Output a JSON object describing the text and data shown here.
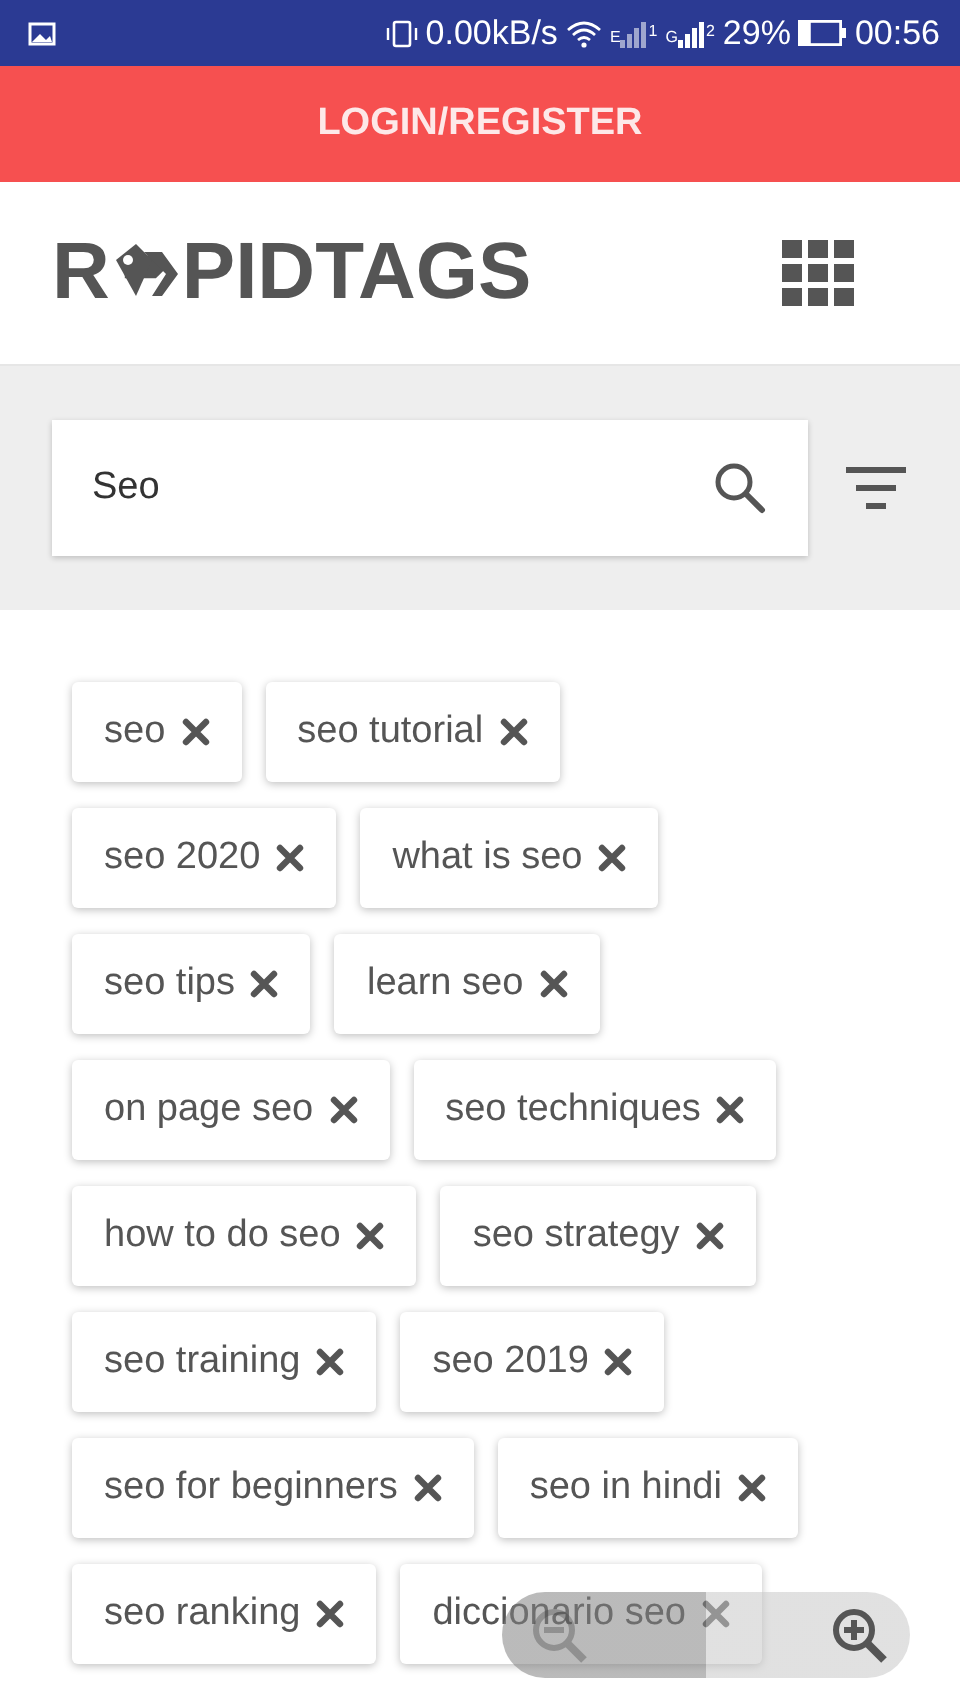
{
  "status_bar": {
    "speed": "0.00kB/s",
    "sims": [
      {
        "network": "E",
        "slot": "1",
        "active": false
      },
      {
        "network": "G",
        "slot": "2",
        "active": true
      }
    ],
    "battery": {
      "label": "29%",
      "level": 0.29
    },
    "time": "00:56"
  },
  "login_bar": {
    "label": "LOGIN/REGISTER"
  },
  "header": {
    "logo_start": "R",
    "logo_end": "PIDTAGS"
  },
  "search": {
    "value": "Seo"
  },
  "tag_rows": [
    [
      "seo",
      "seo tutorial"
    ],
    [
      "seo 2020",
      "what is seo"
    ],
    [
      "seo tips",
      "learn seo"
    ],
    [
      "on page seo",
      "seo techniques"
    ],
    [
      "how to do seo",
      "seo strategy"
    ],
    [
      "seo training",
      "seo 2019"
    ],
    [
      "seo for beginners",
      "seo in hindi"
    ],
    [
      "seo ranking",
      "diccionario seo"
    ]
  ]
}
